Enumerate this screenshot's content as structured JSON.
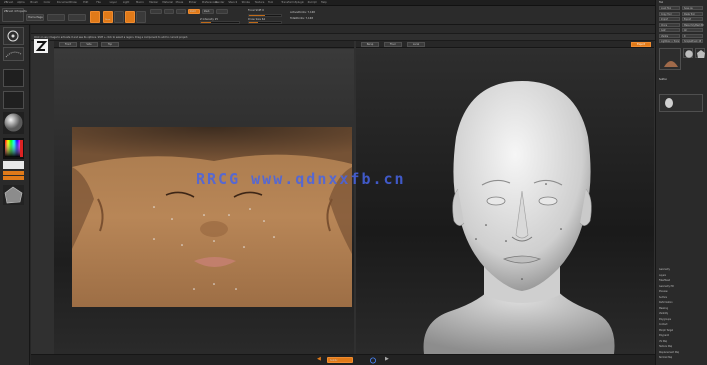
{
  "menubar": {
    "items": [
      "ZBrush",
      "Alpha",
      "Brush",
      "Color",
      "Document",
      "Draw",
      "Edit",
      "File",
      "Layer",
      "Light",
      "Macro",
      "Marker",
      "Material",
      "Movie",
      "Picker",
      "Preferences",
      "Render",
      "Stencil",
      "Stroke",
      "Texture",
      "Tool",
      "Transform",
      "Zplugin",
      "Zscript",
      "Help"
    ]
  },
  "toolbar": {
    "project_label": "ZBrush 4 Projects",
    "home_label": "Home Page",
    "draw_label": "Draw",
    "zadd_label": "Zadd",
    "zsub_label": "Zsub",
    "focal_label": "Focal Shift 0",
    "draw_size_label": "Draw Size 64",
    "z_intensity_label": "Z Intensity 25",
    "active_points": "ActivePoints: 7,168",
    "total_points": "TotalPoints: 7,168"
  },
  "notebar": {
    "text": "Click on any image to activate it and see its options. Shift + click to select a region. Drag a component to add to current project."
  },
  "tabs": {
    "left": [
      "Front",
      "Side",
      "Top"
    ],
    "right": [
      "Persp",
      "Floor",
      "Local"
    ],
    "action": "Export"
  },
  "bottombar": {
    "button_label": "Subdiv"
  },
  "rightpanel": {
    "title": "Tool",
    "rows": [
      "Load Tool",
      "Save As",
      "Copy Tool",
      "Paste Tool",
      "Import",
      "Export",
      "Clone",
      "Make PolyMesh3D",
      "GoZ",
      "All",
      "Visible",
      "R",
      "Lightbox > Tools",
      "SimpleBrush 48"
    ],
    "subtools_label": "Subtool",
    "lower_rows": [
      "Geometry",
      "Layers",
      "FiberMesh",
      "Geometry HD",
      "Preview",
      "Surface",
      "Deformation",
      "Masking",
      "Visibility",
      "Polygroups",
      "Contact",
      "Morph Target",
      "Polypaint",
      "UV Map",
      "Texture Map",
      "Displacement Map",
      "Normal Map"
    ]
  },
  "watermark": {
    "text": "RRCG www.qdnxxfb.cn"
  },
  "colors": {
    "accent": "#e07a19",
    "background": "#262626",
    "watermark": "#4664e6"
  }
}
